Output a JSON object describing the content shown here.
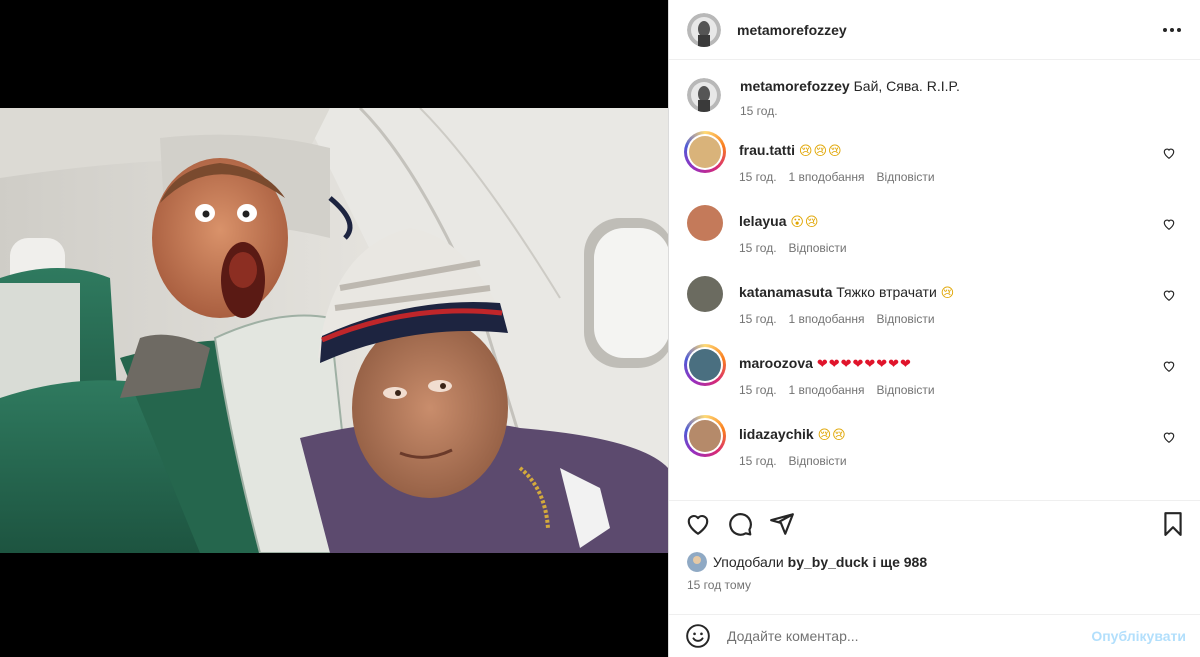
{
  "post": {
    "author": "metamorefozzey",
    "more_icon": "more-horizontal-icon",
    "caption": {
      "username": "metamorefozzey",
      "text": "Бай, Сява. R.I.P.",
      "time": "15 год."
    },
    "comments": [
      {
        "username": "frau.tatti",
        "emoji": "😢😢😢",
        "emoji_color": "sad",
        "time": "15 год.",
        "likes": "1 вподобання",
        "reply": "Відповісти",
        "story_ring": true,
        "avatar_color": "#d9b37a"
      },
      {
        "username": "lelayua",
        "emoji": "😮😢",
        "emoji_color": "sad",
        "time": "15 год.",
        "likes": "",
        "reply": "Відповісти",
        "story_ring": false,
        "avatar_color": "#c47a5a"
      },
      {
        "username": "katanamasuta",
        "text": "Тяжко втрачати",
        "emoji": "😢",
        "emoji_color": "sad",
        "time": "15 год.",
        "likes": "1 вподобання",
        "reply": "Відповісти",
        "story_ring": false,
        "avatar_color": "#6b6b60"
      },
      {
        "username": "maroozova",
        "emoji": "❤❤❤❤❤❤❤❤",
        "emoji_color": "red",
        "time": "15 год.",
        "likes": "1 вподобання",
        "reply": "Відповісти",
        "story_ring": true,
        "avatar_color": "#4a6f80"
      },
      {
        "username": "lidazaychik",
        "emoji": "😢😢",
        "emoji_color": "sad",
        "time": "15 год.",
        "likes": "",
        "reply": "Відповісти",
        "story_ring": true,
        "avatar_color": "#b58a6a"
      }
    ],
    "likes": {
      "prefix": "Уподобали",
      "user": "by_by_duck",
      "suffix": "і ще 988"
    },
    "posted": "15 год тому",
    "add_comment": {
      "placeholder": "Додайте коментар...",
      "post_label": "Опублікувати"
    },
    "icons": {
      "like": "heart-icon",
      "comment": "comment-icon",
      "share": "share-icon",
      "save": "bookmark-icon",
      "emoji": "emoji-icon"
    },
    "colors": {
      "text": "#262626",
      "secondary": "#737373",
      "post_button_disabled": "#b2dffc"
    }
  }
}
